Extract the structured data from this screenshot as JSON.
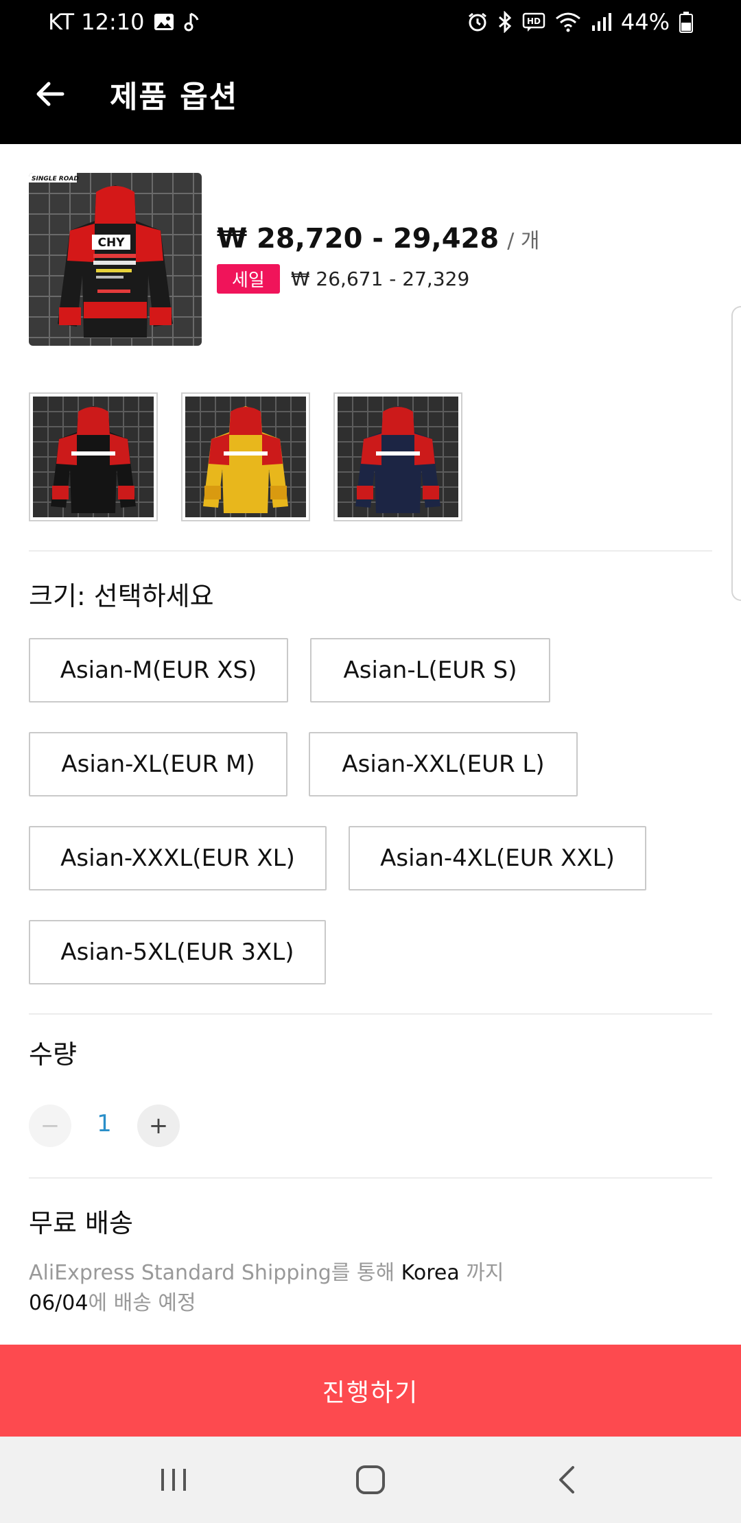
{
  "status_bar": {
    "carrier_time": "KT 12:10",
    "hd_label": "HD",
    "battery": "44%",
    "icons": [
      "image-icon",
      "music-note-icon",
      "alarm-icon",
      "bluetooth-icon",
      "hd-voice-icon",
      "wifi-icon",
      "signal-icon",
      "battery-icon"
    ]
  },
  "app_bar": {
    "title": "제품 옵션",
    "back_icon": "arrow-left-icon"
  },
  "product": {
    "price_range": "₩ 28,720 - 29,428",
    "price_unit": "/ 개",
    "sale_badge": "세일",
    "original_price": "₩ 26,671 - 27,329",
    "image_brand_text": "SINGLE ROAD",
    "thumbnails": [
      {
        "color": "black-red"
      },
      {
        "color": "yellow"
      },
      {
        "color": "navy-red"
      }
    ]
  },
  "size": {
    "label": "크기: 선택하세요",
    "options": [
      "Asian-M(EUR XS)",
      "Asian-L(EUR S)",
      "Asian-XL(EUR M)",
      "Asian-XXL(EUR L)",
      "Asian-XXXL(EUR XL)",
      "Asian-4XL(EUR XXL)",
      "Asian-5XL(EUR 3XL)"
    ]
  },
  "quantity": {
    "label": "수량",
    "value": "1",
    "minus": "−",
    "plus": "+"
  },
  "shipping": {
    "title": "무료 배송",
    "line1_service": "AliExpress Standard Shipping",
    "line1_via": "를 통해",
    "line1_dest": "Korea",
    "line1_to": "까지",
    "line2_date": "06/04",
    "line2_suffix": "에 배송 예정"
  },
  "proceed_button": "진행하기",
  "nav_bar": {
    "icons": [
      "recent-apps-icon",
      "home-icon",
      "back-nav-icon"
    ]
  },
  "colors": {
    "accent": "#fd4a4f",
    "sale": "#f0145a",
    "quantity_value": "#2a8fc9"
  }
}
